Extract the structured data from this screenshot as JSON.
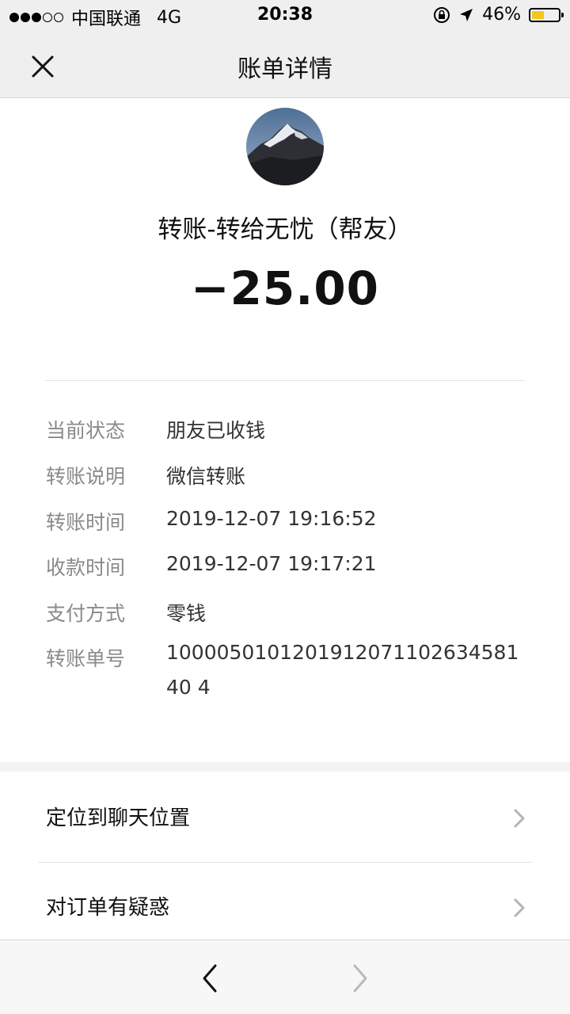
{
  "status_bar": {
    "carrier": "中国联通",
    "network": "4G",
    "time": "20:38",
    "battery": "46%",
    "battery_level": 0.46
  },
  "nav": {
    "title": "账单详情"
  },
  "transaction": {
    "payee": "转账-转给无忧（帮友）",
    "amount": "−25.00"
  },
  "details": [
    {
      "label": "当前状态",
      "value": "朋友已收钱"
    },
    {
      "label": "转账说明",
      "value": "微信转账"
    },
    {
      "label": "转账时间",
      "value": "2019-12-07 19:16:52"
    },
    {
      "label": "收款时间",
      "value": "2019-12-07 19:17:21"
    },
    {
      "label": "支付方式",
      "value": "零钱"
    },
    {
      "label": "转账单号",
      "value": "100005010120191207110263458140 4"
    }
  ],
  "menu": [
    {
      "label": "定位到聊天位置"
    },
    {
      "label": "对订单有疑惑"
    }
  ],
  "colors": {
    "battery": "#f4c61d",
    "label": "#8a8a8a",
    "nav_bg": "#efefef"
  }
}
